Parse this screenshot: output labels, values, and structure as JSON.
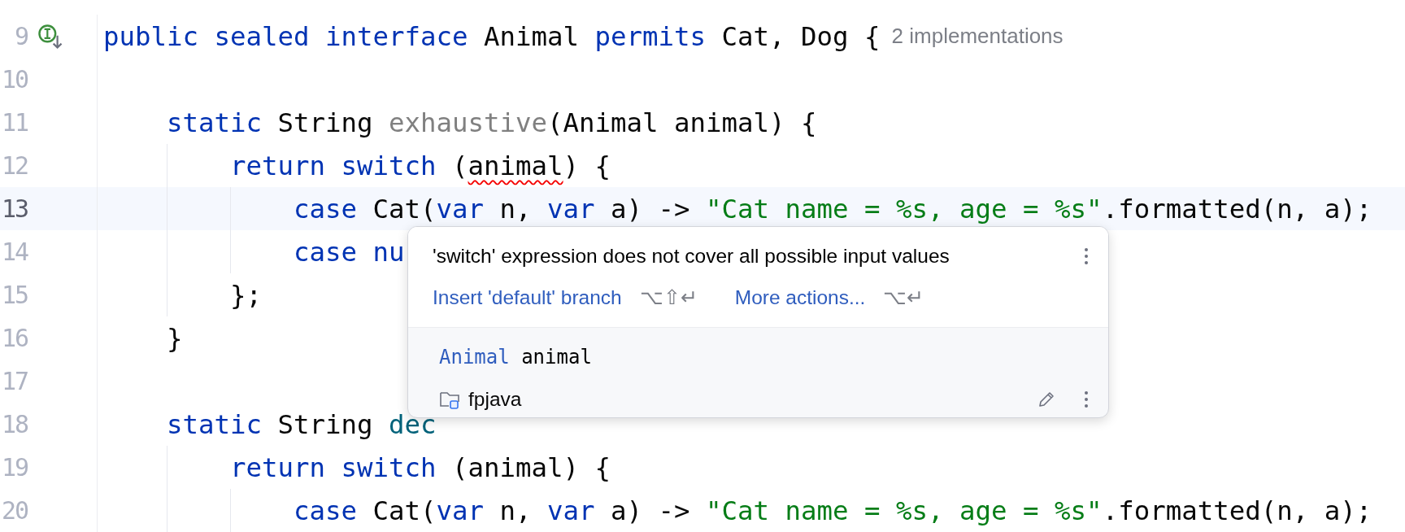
{
  "editor": {
    "lines": [
      {
        "number": "9",
        "current": false,
        "implemented": true,
        "tokens": [
          {
            "kind": "keyword",
            "text": "public sealed interface"
          },
          {
            "kind": "plain",
            "text": " Animal "
          },
          {
            "kind": "keyword",
            "text": "permits"
          },
          {
            "kind": "plain",
            "text": " Cat, Dog {"
          }
        ],
        "inlay_hint": "2 implementations"
      },
      {
        "number": "10",
        "current": false
      },
      {
        "number": "11",
        "current": false,
        "tokens": [
          {
            "kind": "keyword",
            "text": "    static"
          },
          {
            "kind": "plain",
            "text": " String "
          },
          {
            "kind": "unused",
            "text": "exhaustive"
          },
          {
            "kind": "plain",
            "text": "(Animal animal) {"
          }
        ]
      },
      {
        "number": "12",
        "current": false,
        "tokens": [
          {
            "kind": "keyword",
            "text": "        return switch"
          },
          {
            "kind": "plain",
            "text": " ("
          },
          {
            "kind": "plain",
            "text": "animal",
            "error": true
          },
          {
            "kind": "plain",
            "text": ") {"
          }
        ]
      },
      {
        "number": "13",
        "current": true,
        "tokens": [
          {
            "kind": "keyword",
            "text": "            case"
          },
          {
            "kind": "plain",
            "text": " Cat("
          },
          {
            "kind": "keyword",
            "text": "var"
          },
          {
            "kind": "plain",
            "text": " n, "
          },
          {
            "kind": "keyword",
            "text": "var"
          },
          {
            "kind": "plain",
            "text": " a) -> "
          },
          {
            "kind": "string",
            "text": "\"Cat name = %s, age = %s\""
          },
          {
            "kind": "plain",
            "text": ".formatted(n, a);"
          }
        ]
      },
      {
        "number": "14",
        "current": false,
        "tokens": [
          {
            "kind": "keyword",
            "text": "            case nu"
          }
        ]
      },
      {
        "number": "15",
        "current": false,
        "tokens": [
          {
            "kind": "plain",
            "text": "        };"
          }
        ]
      },
      {
        "number": "16",
        "current": false,
        "tokens": [
          {
            "kind": "plain",
            "text": "    }"
          }
        ]
      },
      {
        "number": "17",
        "current": false
      },
      {
        "number": "18",
        "current": false,
        "tokens": [
          {
            "kind": "keyword",
            "text": "    static"
          },
          {
            "kind": "plain",
            "text": " String "
          },
          {
            "kind": "method",
            "text": "dec"
          }
        ]
      },
      {
        "number": "19",
        "current": false,
        "tokens": [
          {
            "kind": "keyword",
            "text": "        return switch"
          },
          {
            "kind": "plain",
            "text": " (animal) {"
          }
        ]
      },
      {
        "number": "20",
        "current": false,
        "tokens": [
          {
            "kind": "keyword",
            "text": "            case"
          },
          {
            "kind": "plain",
            "text": " Cat("
          },
          {
            "kind": "keyword",
            "text": "var"
          },
          {
            "kind": "plain",
            "text": " n, "
          },
          {
            "kind": "keyword",
            "text": "var"
          },
          {
            "kind": "plain",
            "text": " a) -> "
          },
          {
            "kind": "string",
            "text": "\"Cat name = %s, age = %s\""
          },
          {
            "kind": "plain",
            "text": ".formatted(n, a);"
          }
        ]
      }
    ]
  },
  "popup": {
    "message": "'switch' expression does not cover all possible input values",
    "actions": [
      {
        "label": "Insert 'default' branch",
        "shortcut": "⌥⇧↵"
      },
      {
        "label": "More actions...",
        "shortcut": "⌥↵"
      }
    ],
    "signature": {
      "type": "Animal",
      "name": "animal"
    },
    "module": "fpjava"
  }
}
